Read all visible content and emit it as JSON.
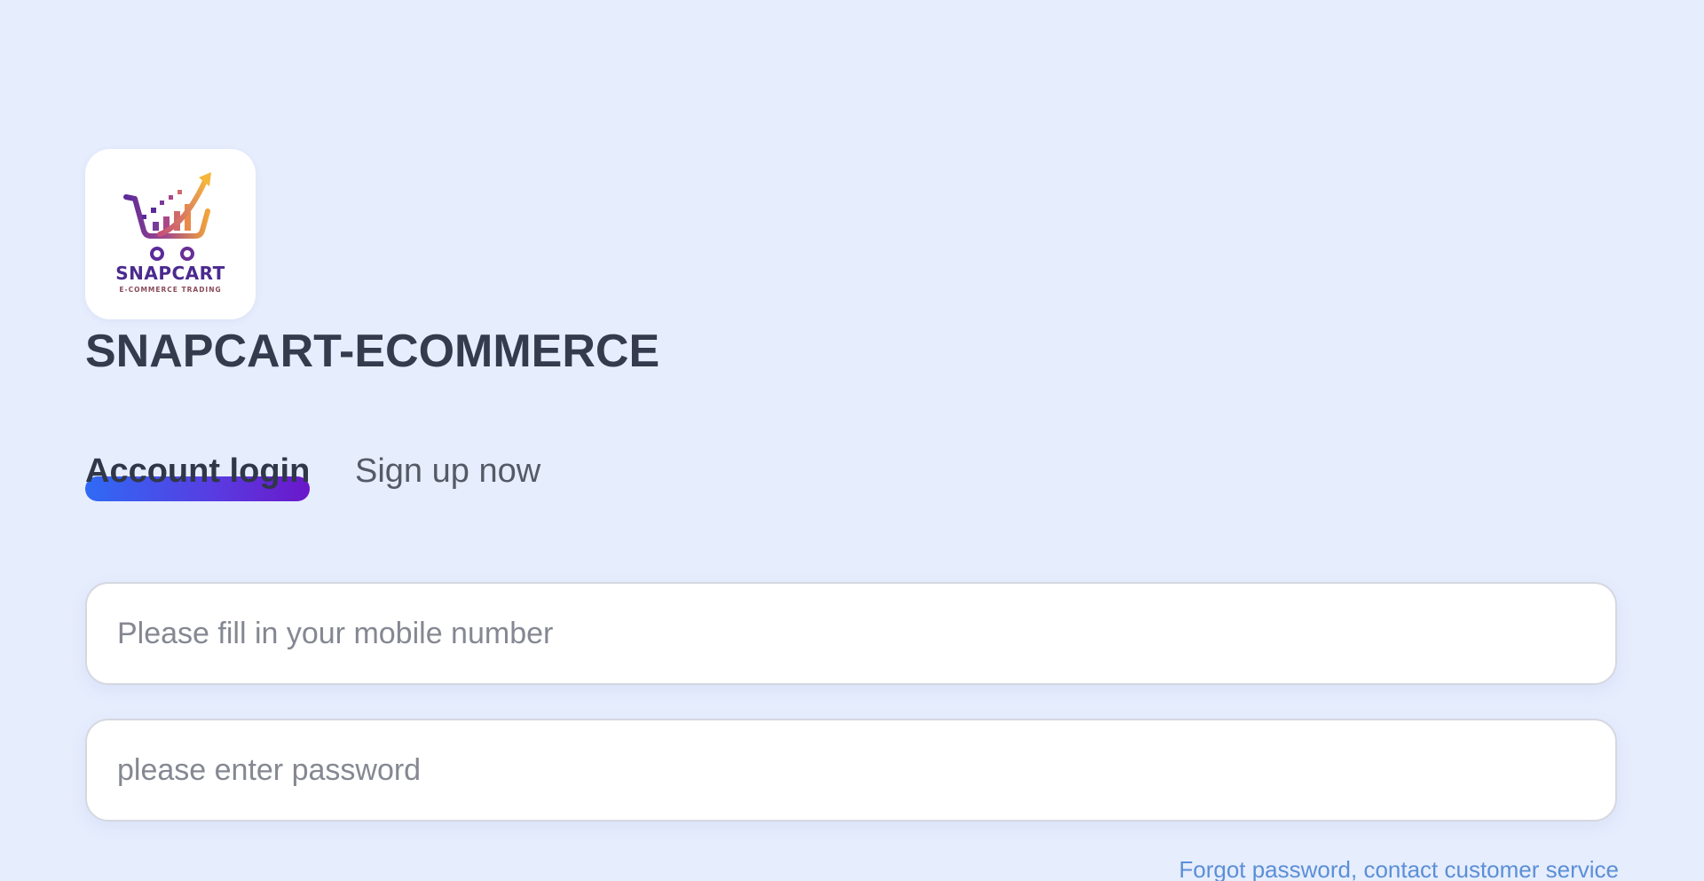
{
  "logo": {
    "icon": "shopping-cart-with-rising-arrow-icon",
    "name": "SNAPCART",
    "tagline": "E-COMMERCE TRADING"
  },
  "brand": {
    "title": "SNAPCART-ECOMMERCE"
  },
  "tabs": [
    {
      "label": "Account login",
      "active": true
    },
    {
      "label": "Sign up now",
      "active": false
    }
  ],
  "form": {
    "phone": {
      "placeholder": "Please fill in your mobile number",
      "value": ""
    },
    "password": {
      "placeholder": "please enter password",
      "value": ""
    }
  },
  "links": {
    "forgot": "Forgot password, contact customer service"
  },
  "colors": {
    "background": "#e6edfd",
    "title": "#333b4d",
    "tab_indicator_start": "#2f6af5",
    "tab_indicator_end": "#6a17c9",
    "link": "#5b8fd6",
    "logo_purple": "#4b2a8f",
    "logo_orange": "#f2a33a"
  }
}
